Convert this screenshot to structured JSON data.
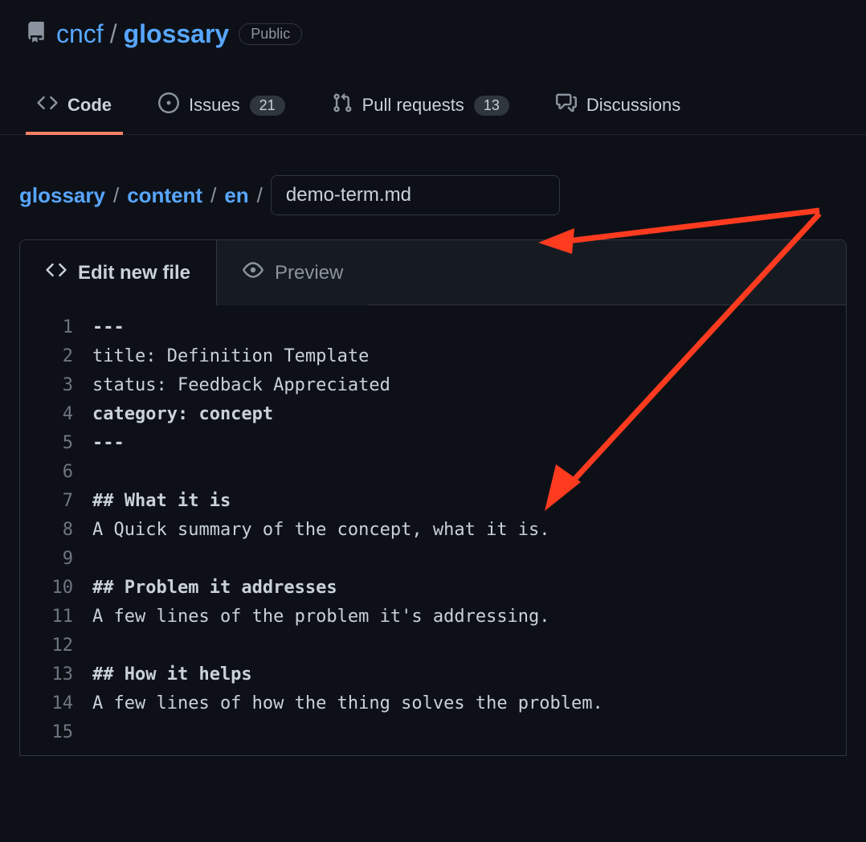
{
  "repo": {
    "owner": "cncf",
    "name": "glossary",
    "visibility": "Public"
  },
  "tabs": {
    "code": "Code",
    "issues": {
      "label": "Issues",
      "count": "21"
    },
    "pulls": {
      "label": "Pull requests",
      "count": "13"
    },
    "discussions": "Discussions"
  },
  "breadcrumb": {
    "root": "glossary",
    "parts": [
      "content",
      "en"
    ],
    "filename": "demo-term.md"
  },
  "editor_tabs": {
    "edit": "Edit new file",
    "preview": "Preview"
  },
  "code_lines": [
    {
      "n": "1",
      "text": "---",
      "bold": true
    },
    {
      "n": "2",
      "text": "title: Definition Template",
      "bold": false
    },
    {
      "n": "3",
      "text": "status: Feedback Appreciated",
      "bold": false
    },
    {
      "n": "4",
      "text": "category: concept",
      "bold": true
    },
    {
      "n": "5",
      "text": "---",
      "bold": true
    },
    {
      "n": "6",
      "text": "",
      "bold": false
    },
    {
      "n": "7",
      "text": "## What it is",
      "bold": true
    },
    {
      "n": "8",
      "text": "A Quick summary of the concept, what it is.",
      "bold": false
    },
    {
      "n": "9",
      "text": "",
      "bold": false
    },
    {
      "n": "10",
      "text": "## Problem it addresses",
      "bold": true
    },
    {
      "n": "11",
      "text": "A few lines of the problem it's addressing.",
      "bold": false
    },
    {
      "n": "12",
      "text": "",
      "bold": false
    },
    {
      "n": "13",
      "text": "## How it helps",
      "bold": true
    },
    {
      "n": "14",
      "text": "A few lines of how the thing solves the problem.",
      "bold": false
    },
    {
      "n": "15",
      "text": "",
      "bold": false
    }
  ]
}
